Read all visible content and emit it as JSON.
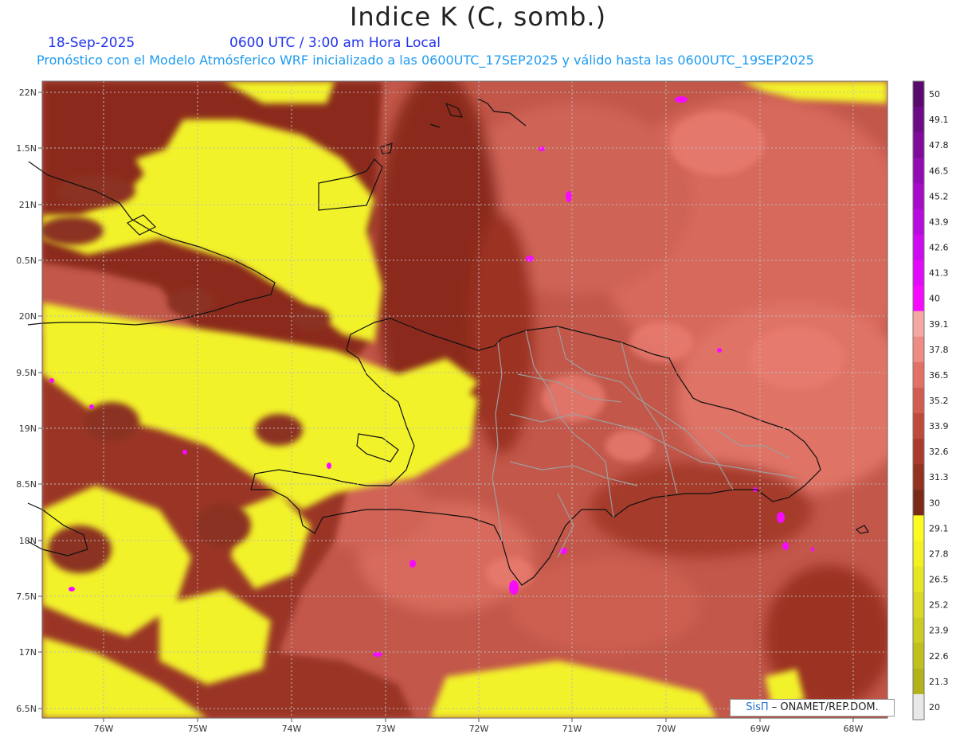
{
  "header": {
    "title": "Indice K (C, somb.)",
    "date": "18-Sep-2025",
    "time": "0600 UTC / 3:00 am Hora Local",
    "subtitle": "Pronóstico con el Modelo Atmósferico WRF inicializado a las 0600UTC_17SEP2025 y válido hasta las  0600UTC_19SEP2025"
  },
  "axes": {
    "lat_labels": [
      "22N",
      "1.5N",
      "21N",
      "0.5N",
      "20N",
      "9.5N",
      "19N",
      "8.5N",
      "18N",
      "7.5N",
      "17N",
      "6.5N"
    ],
    "lon_labels": [
      "76W",
      "75W",
      "74W",
      "73W",
      "72W",
      "71W",
      "70W",
      "69W",
      "68W"
    ]
  },
  "colorbar": {
    "labels": [
      "50",
      "49.1",
      "47.8",
      "46.5",
      "45.2",
      "43.9",
      "42.6",
      "41.3",
      "40",
      "39.1",
      "37.8",
      "36.5",
      "35.2",
      "33.9",
      "32.6",
      "31.3",
      "30",
      "29.1",
      "27.8",
      "26.5",
      "25.2",
      "23.9",
      "22.6",
      "21.3",
      "20"
    ],
    "colors": [
      "#5a0a6e",
      "#6c0b85",
      "#7f0b9c",
      "#920bb3",
      "#a60bc9",
      "#b80bdd",
      "#cc0bef",
      "#e10bfa",
      "#f70bff",
      "#f5a8a2",
      "#ee8c84",
      "#e37166",
      "#d35c50",
      "#bf4a3c",
      "#a93b2c",
      "#93321f",
      "#7a2a16",
      "#fbfb20",
      "#f2f222",
      "#e6e624",
      "#d9d926",
      "#cccc22",
      "#bfbf1e",
      "#b2b21b",
      "#e8e8e8"
    ]
  },
  "footer": {
    "credit_logo": "SisΠ",
    "credit_text": " – ONAMET/REP.DOM."
  },
  "colors": {
    "yellow": "#f2f22a",
    "brown": "#8b2a1a",
    "red": "#cc5a4a",
    "pink": "#ee7d70",
    "magenta": "#f70bff"
  }
}
